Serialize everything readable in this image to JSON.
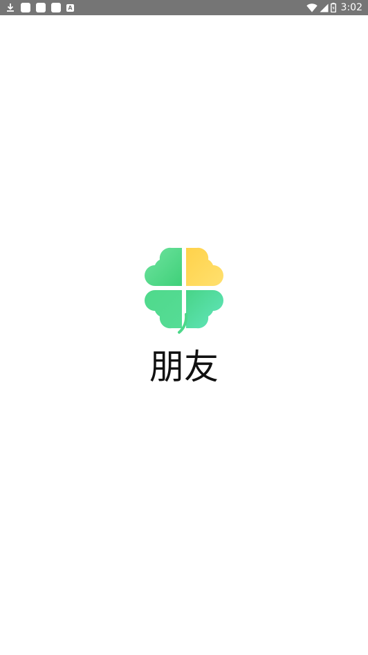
{
  "status_bar": {
    "time": "3:02",
    "left_icons": [
      "download-icon",
      "notification-square-icon",
      "notification-square-icon",
      "notification-square-icon",
      "a-box-icon"
    ],
    "a_box_letter": "A",
    "right_icons": [
      "wifi-icon",
      "signal-icon",
      "battery-icon"
    ],
    "background": "#757575"
  },
  "splash": {
    "app_name": "朋友",
    "logo": "four-leaf-clover-logo",
    "colors": {
      "green": "#4ddc8a",
      "yellow": "#ffd34f",
      "teal": "#55e0b4"
    }
  }
}
